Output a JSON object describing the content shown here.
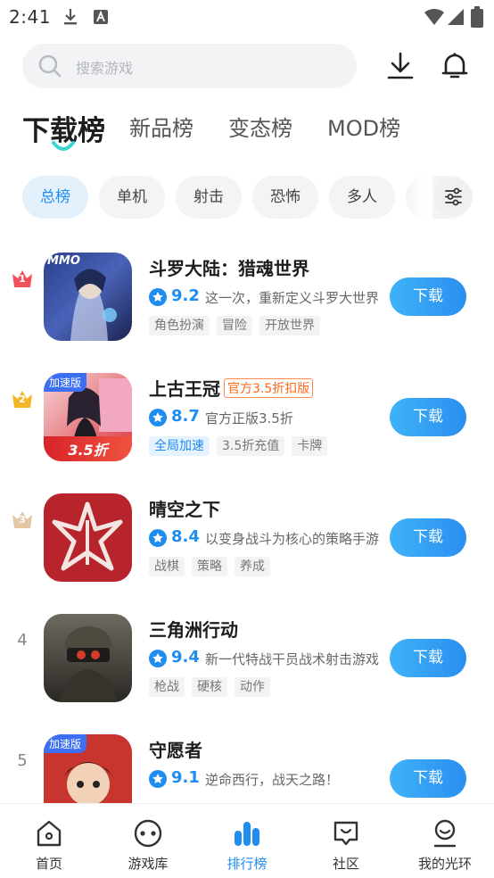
{
  "status_bar": {
    "time": "2:41"
  },
  "search": {
    "placeholder": "搜索游戏"
  },
  "rank_tabs": [
    {
      "label": "下载榜",
      "active": true
    },
    {
      "label": "新品榜",
      "active": false
    },
    {
      "label": "变态榜",
      "active": false
    },
    {
      "label": "MOD榜",
      "active": false
    }
  ],
  "filter_chips": [
    {
      "label": "总榜",
      "active": true
    },
    {
      "label": "单机",
      "active": false
    },
    {
      "label": "射击",
      "active": false
    },
    {
      "label": "恐怖",
      "active": false
    },
    {
      "label": "多人",
      "active": false
    }
  ],
  "games": [
    {
      "rank": "1",
      "name": "斗罗大陆：猎魂世界",
      "offer_badge": "",
      "score": "9.2",
      "desc": "这一次，重新定义斗罗大世界",
      "tags": [
        "角色扮演",
        "冒险",
        "开放世界"
      ],
      "icon_badge": "",
      "icon_caption": "",
      "icon_watermark": "MMO",
      "download_label": "下载"
    },
    {
      "rank": "2",
      "name": "上古王冠",
      "offer_badge": "官方3.5折扣版",
      "score": "8.7",
      "desc": "官方正版3.5折",
      "tags": [
        "全局加速",
        "3.5折充值",
        "卡牌"
      ],
      "icon_badge": "加速版",
      "icon_caption": "3.5折",
      "icon_watermark": "",
      "download_label": "下载"
    },
    {
      "rank": "3",
      "name": "晴空之下",
      "offer_badge": "",
      "score": "8.4",
      "desc": "以变身战斗为核心的策略手游",
      "tags": [
        "战棋",
        "策略",
        "养成"
      ],
      "icon_badge": "",
      "icon_caption": "",
      "icon_watermark": "",
      "download_label": "下载"
    },
    {
      "rank": "4",
      "name": "三角洲行动",
      "offer_badge": "",
      "score": "9.4",
      "desc": "新一代特战干员战术射击游戏",
      "tags": [
        "枪战",
        "硬核",
        "动作"
      ],
      "icon_badge": "",
      "icon_caption": "",
      "icon_watermark": "",
      "download_label": "下载"
    },
    {
      "rank": "5",
      "name": "守愿者",
      "offer_badge": "",
      "score": "9.1",
      "desc": "逆命西行，战天之路！",
      "tags": [],
      "icon_badge": "加速版",
      "icon_caption": "",
      "icon_watermark": "",
      "download_label": "下载"
    }
  ],
  "bottom_nav": [
    {
      "label": "首页",
      "icon": "home-icon",
      "active": false
    },
    {
      "label": "游戏库",
      "icon": "gamepad-icon",
      "active": false
    },
    {
      "label": "排行榜",
      "icon": "ranking-icon",
      "active": true
    },
    {
      "label": "社区",
      "icon": "community-icon",
      "active": false
    },
    {
      "label": "我的光环",
      "icon": "profile-icon",
      "active": false
    }
  ],
  "colors": {
    "accent": "#1f8cf0",
    "download_gradient_start": "#3fb2f8",
    "download_gradient_end": "#2a8ff0",
    "offer_orange": "#ff6a1a"
  }
}
